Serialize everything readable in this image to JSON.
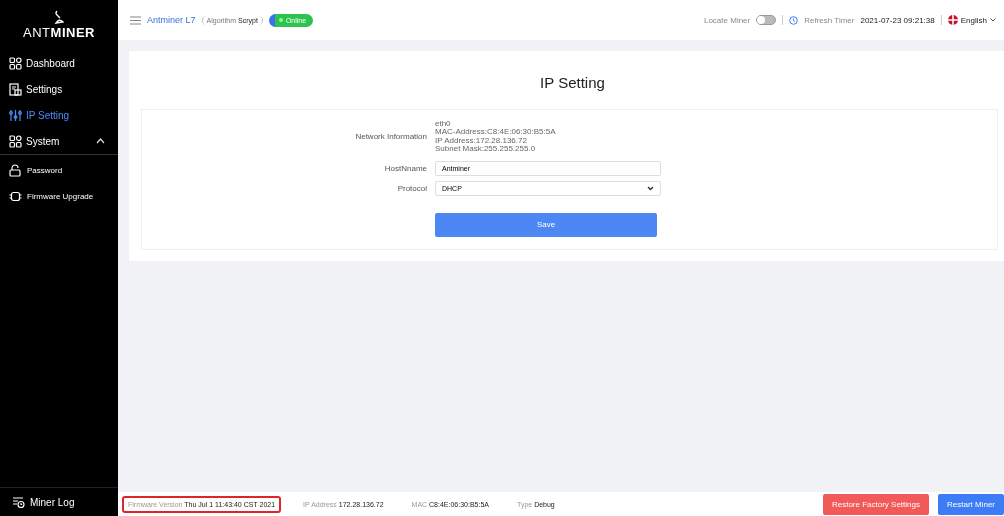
{
  "sidebar": {
    "logo": "ANT**MINER**",
    "items": [
      {
        "label": "Dashboard",
        "selected": false
      },
      {
        "label": "Settings",
        "selected": false
      },
      {
        "label": "IP Setting",
        "selected": true
      },
      {
        "label": "System",
        "selected": false,
        "expanded": true,
        "children": [
          {
            "label": "Password",
            "selected": false
          },
          {
            "label": "Firmware Upgrade",
            "selected": false
          }
        ]
      }
    ],
    "log": "Miner Log"
  },
  "header": {
    "model": "Antminer L7",
    "algorithm_label": "Algorithm",
    "algorithm": "Scrypt",
    "status": "Online",
    "locate_label": "Locate Miner",
    "locate_on": false,
    "refresh_label": "Refresh Timer",
    "refresh_time": "2021-07-23 09:21:38",
    "language": "English"
  },
  "page": {
    "title": "IP Setting",
    "fields": [
      {
        "kind": "info",
        "label": "Network Information",
        "lines": [
          "eth0",
          "MAC-Address:C8:4E:06:30:B5:5A",
          "IP Address:172.28.136.72",
          "Subnet Mask:255.255.255.0"
        ]
      },
      {
        "kind": "text",
        "label": "HostNname",
        "value": "Antminer"
      },
      {
        "kind": "select",
        "label": "Protocol",
        "value": "DHCP"
      }
    ],
    "save": "Save"
  },
  "status_bar": {
    "items": [
      {
        "label": "Firmware Version",
        "value": "Thu Jul 1 11:43:40 CST 2021",
        "highlighted": true
      },
      {
        "label": "IP Address",
        "value": "172.28.136.72",
        "highlighted": false
      },
      {
        "label": "MAC",
        "value": "C8:4E:06:30:B5:5A",
        "highlighted": false
      },
      {
        "label": "Type",
        "value": "Debug",
        "highlighted": false
      }
    ],
    "buttons": [
      {
        "label": "Restore Factory Settings",
        "kind": "danger"
      },
      {
        "label": "Restart Miner",
        "kind": "primary"
      }
    ]
  }
}
